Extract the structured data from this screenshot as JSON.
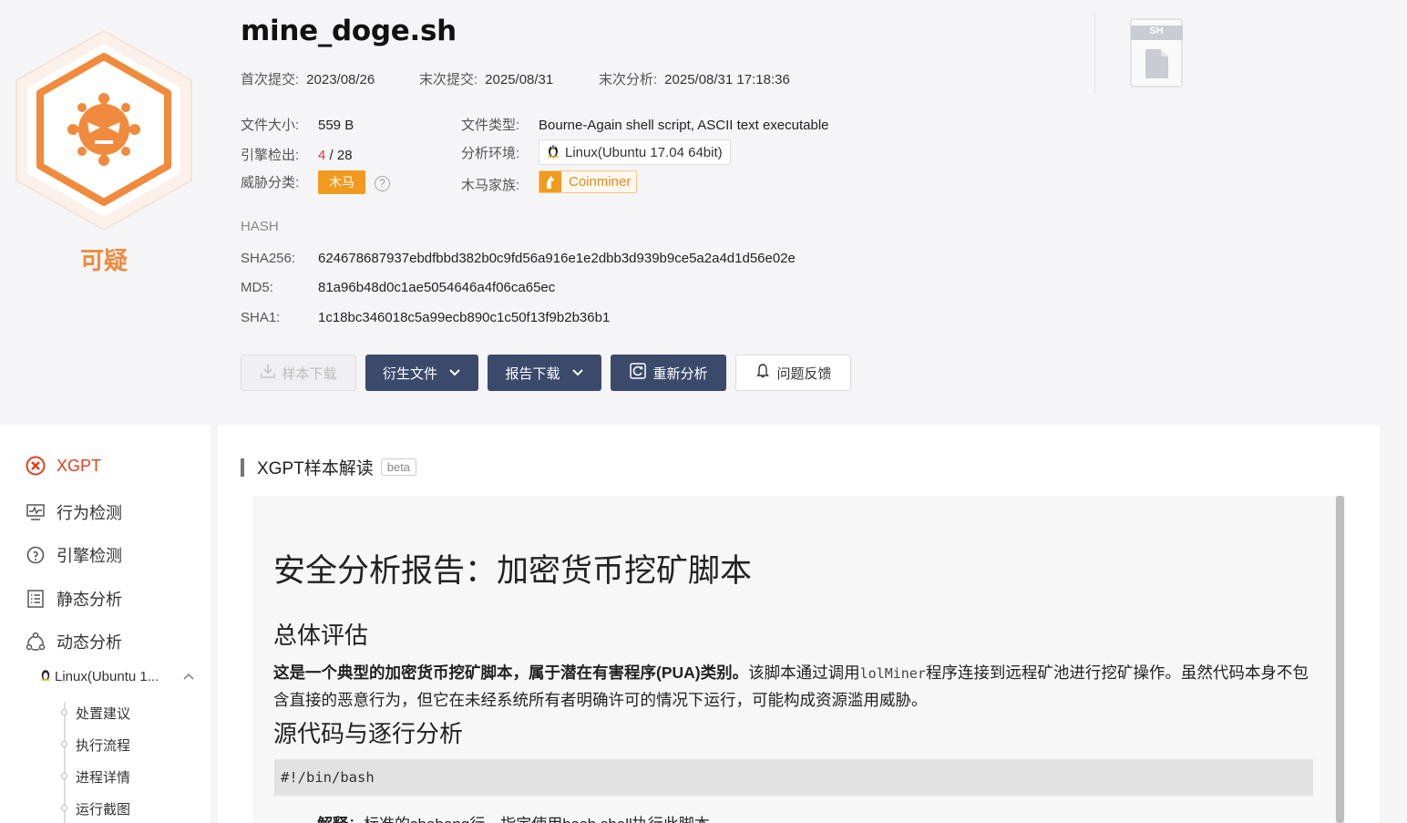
{
  "verdict": {
    "label": "可疑",
    "icon": "virus-icon"
  },
  "file": {
    "name": "mine_doge.sh",
    "first_submit_label": "首次提交:",
    "first_submit": "2023/08/26",
    "last_submit_label": "末次提交:",
    "last_submit": "2025/08/31",
    "last_analysis_label": "末次分析:",
    "last_analysis": "2025/08/31 17:18:36",
    "size_label": "文件大小:",
    "size": "559 B",
    "type_label": "文件类型:",
    "type": "Bourne-Again shell script, ASCII text executable",
    "engine_label": "引擎检出:",
    "engine_hits": "4",
    "engine_sep": " / ",
    "engine_total": "28",
    "env_label": "分析环境:",
    "env": "Linux(Ubuntu 17.04 64bit)",
    "threat_label": "威胁分类:",
    "threat": "木马",
    "family_label": "木马家族:",
    "family": "Coinminer",
    "file_icon_tag": "SH"
  },
  "hash": {
    "title": "HASH",
    "sha256_label": "SHA256:",
    "sha256": "624678687937ebdfbbd382b0c9fd56a916e1e2dbb3d939b9ce5a2a4d1d56e02e",
    "md5_label": "MD5:",
    "md5": "81a96b48d0c1ae5054646a4f06ca65ec",
    "sha1_label": "SHA1:",
    "sha1": "1c18bc346018c5a99ecb890c1c50f13f9b2b36b1"
  },
  "actions": {
    "download": "样本下载",
    "derived": "衍生文件",
    "report": "报告下载",
    "reanalyze": "重新分析",
    "feedback": "问题反馈"
  },
  "sidebar": {
    "items": [
      {
        "label": "XGPT",
        "icon": "xgpt-icon"
      },
      {
        "label": "行为检测",
        "icon": "monitor-icon"
      },
      {
        "label": "引擎检测",
        "icon": "engine-icon"
      },
      {
        "label": "静态分析",
        "icon": "list-icon"
      },
      {
        "label": "动态分析",
        "icon": "share-icon"
      }
    ],
    "env": "Linux(Ubuntu 1...",
    "sub_items": [
      "处置建议",
      "执行流程",
      "进程详情",
      "运行截图"
    ]
  },
  "section": {
    "title": "XGPT样本解读",
    "badge": "beta"
  },
  "report": {
    "h1": "安全分析报告：加密货币挖矿脚本",
    "h2_overall": "总体评估",
    "p_bold": "这是一个典型的加密货币挖矿脚本，属于潜在有害程序(PUA)类别。",
    "p_pre": "该脚本通过调用",
    "p_code": "lolMiner",
    "p_post": "程序连接到远程矿池进行挖矿操作。虽然代码本身不包含直接的恶意行为，但它在未经系统所有者明确许可的情况下运行，可能构成资源滥用威胁。",
    "h2_source": "源代码与逐行分析",
    "code_line": "#!/bin/bash",
    "li_bold": "解释",
    "li_text": "：标准的shebang行，指定使用bash shell执行此脚本。"
  },
  "colors": {
    "accent": "#f08a3c",
    "dark_btn": "#3b4a6b",
    "danger": "#d9363e",
    "active_nav": "#e0401f"
  }
}
